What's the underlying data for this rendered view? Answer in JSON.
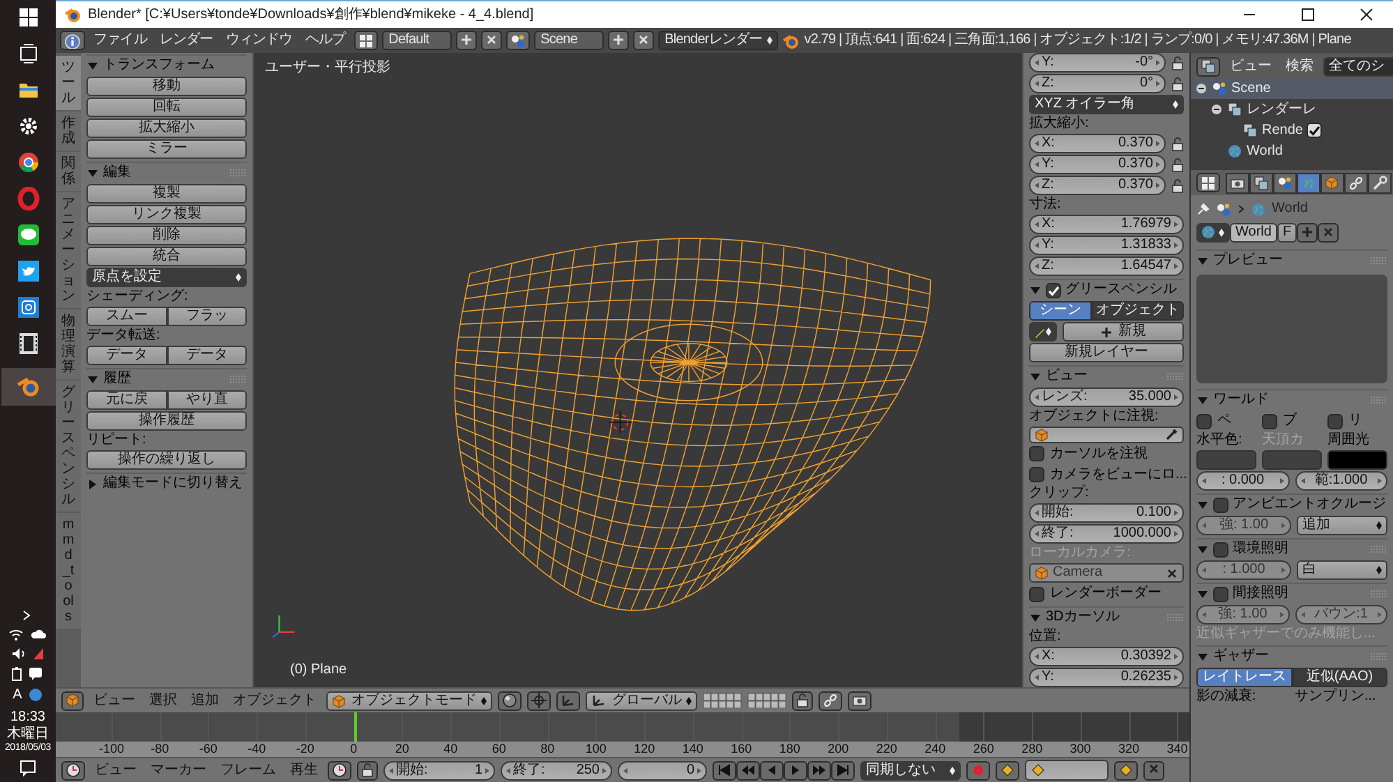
{
  "taskbar": {
    "ime": "A",
    "time": "18:33",
    "weekday": "木曜日",
    "date": "2018/05/03"
  },
  "title_bar": {
    "title": "Blender* [C:¥Users¥tonde¥Downloads¥創作¥blend¥mikeke - 4_4.blend]"
  },
  "info_header": {
    "menus": [
      "ファイル",
      "レンダー",
      "ウィンドウ",
      "ヘルプ"
    ],
    "screen_layout": "Default",
    "scene": "Scene",
    "render_engine": "Blenderレンダー",
    "stats": "v2.79 | 頂点:641 | 面:624 | 三角面:1,166 | オブジェクト:1/2 | ランプ:0/0 | メモリ:47.36M | Plane"
  },
  "tool_tabs": [
    {
      "label": "ツール",
      "selected": true
    },
    {
      "label": "作成",
      "selected": false
    },
    {
      "label": "関係",
      "selected": false
    },
    {
      "label": "アニメーション",
      "selected": false
    },
    {
      "label": "物理演算",
      "selected": false
    },
    {
      "label": "グリースペンシル",
      "selected": false
    },
    {
      "label": "mmd_tools",
      "selected": false
    }
  ],
  "tool_panel": [
    {
      "kind": "header",
      "title": "トランスフォーム",
      "expanded": true
    },
    {
      "kind": "button",
      "label": "移動"
    },
    {
      "kind": "button",
      "label": "回転"
    },
    {
      "kind": "button",
      "label": "拡大縮小"
    },
    {
      "kind": "button",
      "label": "ミラー"
    },
    {
      "kind": "header",
      "title": "編集",
      "expanded": true,
      "grip": true
    },
    {
      "kind": "button",
      "label": "複製"
    },
    {
      "kind": "button",
      "label": "リンク複製"
    },
    {
      "kind": "button",
      "label": "削除"
    },
    {
      "kind": "button",
      "label": "統合"
    },
    {
      "kind": "menu",
      "label": "原点を設定"
    },
    {
      "kind": "label",
      "text": "シェーディング:"
    },
    {
      "kind": "pair",
      "labels": [
        "スムー",
        "フラッ"
      ]
    },
    {
      "kind": "label",
      "text": "データ転送:"
    },
    {
      "kind": "pair",
      "labels": [
        "データ",
        "データ"
      ]
    },
    {
      "kind": "header",
      "title": "履歴",
      "expanded": true,
      "grip": true
    },
    {
      "kind": "pair",
      "labels": [
        "元に戻",
        "やり直"
      ]
    },
    {
      "kind": "button",
      "label": "操作履歴"
    },
    {
      "kind": "label",
      "text": "リピート:"
    },
    {
      "kind": "button",
      "label": "操作の繰り返し"
    },
    {
      "kind": "header",
      "title": "編集モードに切り替え",
      "expanded": false
    }
  ],
  "viewport": {
    "view_label": "ユーザー・平行投影",
    "object_label": "(0) Plane"
  },
  "properties_region": [
    {
      "kind": "field",
      "label": "Y:",
      "value": "-0°",
      "lock": true
    },
    {
      "kind": "field",
      "label": "Z:",
      "value": "0°",
      "lock": true
    },
    {
      "kind": "menu",
      "label": "XYZ オイラー角"
    },
    {
      "kind": "label",
      "text": "拡大縮小:"
    },
    {
      "kind": "field",
      "label": "X:",
      "value": "0.370",
      "lock": true
    },
    {
      "kind": "field",
      "label": "Y:",
      "value": "0.370",
      "lock": true
    },
    {
      "kind": "field",
      "label": "Z:",
      "value": "0.370",
      "lock": true
    },
    {
      "kind": "label",
      "text": "寸法:"
    },
    {
      "kind": "field",
      "label": "X:",
      "value": "1.76979"
    },
    {
      "kind": "field",
      "label": "Y:",
      "value": "1.31833"
    },
    {
      "kind": "field",
      "label": "Z:",
      "value": "1.64547"
    },
    {
      "kind": "header",
      "title": "グリースペンシル",
      "expanded": true,
      "checkbox": true
    },
    {
      "kind": "toggle",
      "options": [
        {
          "label": "シーン",
          "selected": true
        },
        {
          "label": "オブジェクト",
          "selected": false
        }
      ]
    },
    {
      "kind": "new_row",
      "label": "新規"
    },
    {
      "kind": "button",
      "label": "新規レイヤー"
    },
    {
      "kind": "header",
      "title": "ビュー",
      "expanded": true,
      "grip": true
    },
    {
      "kind": "field",
      "label": "レンズ:",
      "value": "35.000"
    },
    {
      "kind": "label",
      "text": "オブジェクトに注視:"
    },
    {
      "kind": "object_field",
      "disabled": false
    },
    {
      "kind": "checkbox",
      "label": "カーソルを注視",
      "checked": false
    },
    {
      "kind": "checkbox",
      "label": "カメラをビューにロ...",
      "checked": false
    },
    {
      "kind": "label",
      "text": "クリップ:"
    },
    {
      "kind": "field",
      "label": "開始:",
      "value": "0.100"
    },
    {
      "kind": "field",
      "label": "終了:",
      "value": "1000.000"
    },
    {
      "kind": "label",
      "text": "ローカルカメラ:",
      "disabled": true
    },
    {
      "kind": "object_field",
      "value": "Camera",
      "disabled": true
    },
    {
      "kind": "checkbox",
      "label": "レンダーボーダー",
      "checked": false
    },
    {
      "kind": "header",
      "title": "3Dカーソル",
      "expanded": true,
      "grip": true
    },
    {
      "kind": "label",
      "text": "位置:"
    },
    {
      "kind": "field",
      "label": "X:",
      "value": "0.30392"
    },
    {
      "kind": "field",
      "label": "Y:",
      "value": "0.26235"
    }
  ],
  "outliner": {
    "menus": [
      "ビュー",
      "検索"
    ],
    "filter": "全てのシ",
    "tree": [
      {
        "kind": "scene",
        "label": "Scene",
        "expanded": true,
        "selected": true,
        "children": [
          {
            "kind": "render_layers",
            "label": "レンダーレ",
            "expanded": true,
            "selected": false,
            "children": [
              {
                "kind": "render_layer",
                "label": "Rende",
                "checked": true,
                "selected": false
              }
            ]
          },
          {
            "kind": "world",
            "label": "World",
            "selected": false
          }
        ]
      }
    ]
  },
  "properties": {
    "tabs": [
      {
        "kind": "render",
        "selected": false
      },
      {
        "kind": "render_layers",
        "selected": false
      },
      {
        "kind": "scene",
        "selected": false
      },
      {
        "kind": "world",
        "selected": true
      },
      {
        "kind": "object",
        "selected": false
      },
      {
        "kind": "constraints",
        "selected": false
      },
      {
        "kind": "modifiers",
        "selected": false
      }
    ],
    "breadcrumb": "World",
    "world_name": "World",
    "fake_user": "F",
    "panels": [
      {
        "kind": "header",
        "title": "プレビュー",
        "expanded": true,
        "grip": true
      },
      {
        "kind": "preview"
      },
      {
        "kind": "header",
        "title": "ワールド",
        "expanded": true,
        "grip": true
      },
      {
        "kind": "row",
        "cells": [
          {
            "kind": "checkbox",
            "label": "ペ",
            "checked": false
          },
          {
            "kind": "checkbox",
            "label": "ブ",
            "checked": false
          },
          {
            "kind": "checkbox",
            "label": "リ",
            "checked": false
          }
        ]
      },
      {
        "kind": "row",
        "cells": [
          {
            "kind": "label",
            "text": "水平色:"
          },
          {
            "kind": "label",
            "text": "天頂カ",
            "disabled": true
          },
          {
            "kind": "label",
            "text": "周囲光"
          }
        ]
      },
      {
        "kind": "row",
        "cells": [
          {
            "kind": "swatch",
            "color": "#404040"
          },
          {
            "kind": "swatch",
            "color": "#404040"
          },
          {
            "kind": "swatch",
            "color": "#000000"
          }
        ]
      },
      {
        "kind": "row",
        "cells": [
          {
            "kind": "field",
            "text": ": 0.000"
          },
          {
            "kind": "field",
            "text": "範:1.000"
          }
        ]
      },
      {
        "kind": "header",
        "title": "アンビエントオクルージ",
        "expanded": true,
        "checkbox": false
      },
      {
        "kind": "row",
        "cells": [
          {
            "kind": "field",
            "text": "強: 1.00",
            "disabled": true
          },
          {
            "kind": "dropdown",
            "label": "追加"
          }
        ]
      },
      {
        "kind": "header",
        "title": "環境照明",
        "expanded": true,
        "checkbox": false,
        "grip": true
      },
      {
        "kind": "row",
        "cells": [
          {
            "kind": "field",
            "text": ": 1.000",
            "disabled": true
          },
          {
            "kind": "dropdown",
            "label": "白"
          }
        ]
      },
      {
        "kind": "header",
        "title": "間接照明",
        "expanded": true,
        "checkbox": false,
        "grip": true
      },
      {
        "kind": "row",
        "cells": [
          {
            "kind": "field",
            "text": "強: 1.00",
            "disabled": true
          },
          {
            "kind": "field",
            "text": "バウン:1",
            "disabled": true
          }
        ]
      },
      {
        "kind": "label",
        "text": "近似ギャザーでのみ機能し...",
        "disabled": true
      },
      {
        "kind": "header",
        "title": "ギャザー",
        "expanded": true,
        "grip": true
      },
      {
        "kind": "toggle",
        "options": [
          {
            "label": "レイトレース",
            "selected": true
          },
          {
            "label": "近似(AAO)",
            "selected": false
          }
        ]
      },
      {
        "kind": "row",
        "cells": [
          {
            "kind": "label",
            "text": "影の減衰:"
          },
          {
            "kind": "label",
            "text": "サンプリン..."
          }
        ]
      }
    ]
  },
  "view3d_header": {
    "menus": [
      "ビュー",
      "選択",
      "追加",
      "オブジェクト"
    ],
    "mode": "オブジェクトモード",
    "orientation": "グローバル"
  },
  "timeline": {
    "ruler": [
      "-100",
      "-80",
      "-60",
      "-40",
      "-20",
      "0",
      "20",
      "40",
      "60",
      "80",
      "100",
      "120",
      "140",
      "160",
      "180",
      "200",
      "220",
      "240",
      "260",
      "280",
      "300",
      "320",
      "340"
    ],
    "menus": [
      "ビュー",
      "マーカー",
      "フレーム",
      "再生"
    ],
    "start": {
      "label": "開始:",
      "value": "1"
    },
    "end": {
      "label": "終了:",
      "value": "250"
    },
    "current_frame": "0",
    "sync": "同期しない"
  }
}
